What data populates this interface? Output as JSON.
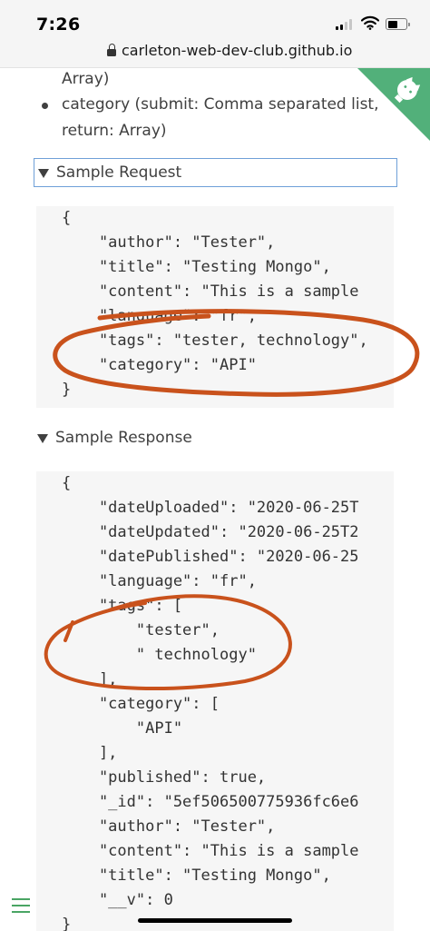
{
  "status_bar": {
    "time": "7:26",
    "icons": [
      "signal-icon",
      "wifi-icon",
      "battery-icon"
    ]
  },
  "address_bar": {
    "url": "carleton-web-dev-club.github.io",
    "icon": "lock-icon"
  },
  "doc": {
    "array_line": "Array)",
    "category_line_1": "category (submit: Comma separated list,",
    "category_line_2": "return: Array)",
    "ribbon_icon": "github-cat-icon"
  },
  "sample_request": {
    "label": "Sample Request",
    "lines": [
      "{",
      "    \"author\": \"Tester\",",
      "    \"title\": \"Testing Mongo\",",
      "    \"content\": \"This is a sample",
      "    \"language\": \"fr\",",
      "    \"tags\": \"tester, technology\",",
      "    \"category\": \"API\"",
      "}"
    ]
  },
  "sample_response": {
    "label": "Sample Response",
    "lines": [
      "{",
      "    \"dateUploaded\": \"2020-06-25T",
      "    \"dateUpdated\": \"2020-06-25T2",
      "    \"datePublished\": \"2020-06-25",
      "    \"language\": \"fr\",",
      "    \"tags\": [",
      "        \"tester\",",
      "        \" technology\"",
      "    ],",
      "    \"category\": [",
      "        \"API\"",
      "    ],",
      "    \"published\": true,",
      "    \"_id\": \"5ef506500775936fc6e6",
      "    \"author\": \"Tester\",",
      "    \"content\": \"This is a sample",
      "    \"title\": \"Testing Mongo\",",
      "    \"__v\": 0",
      "}"
    ]
  },
  "bottom": {
    "menu_icon": "hamburger-menu-icon"
  },
  "colors": {
    "annotation": "#c9521c",
    "menu_accent": "#4aa564",
    "ribbon": "#52b07a",
    "code_bg": "#f6f6f6",
    "header_outline": "#6fa0d8"
  }
}
